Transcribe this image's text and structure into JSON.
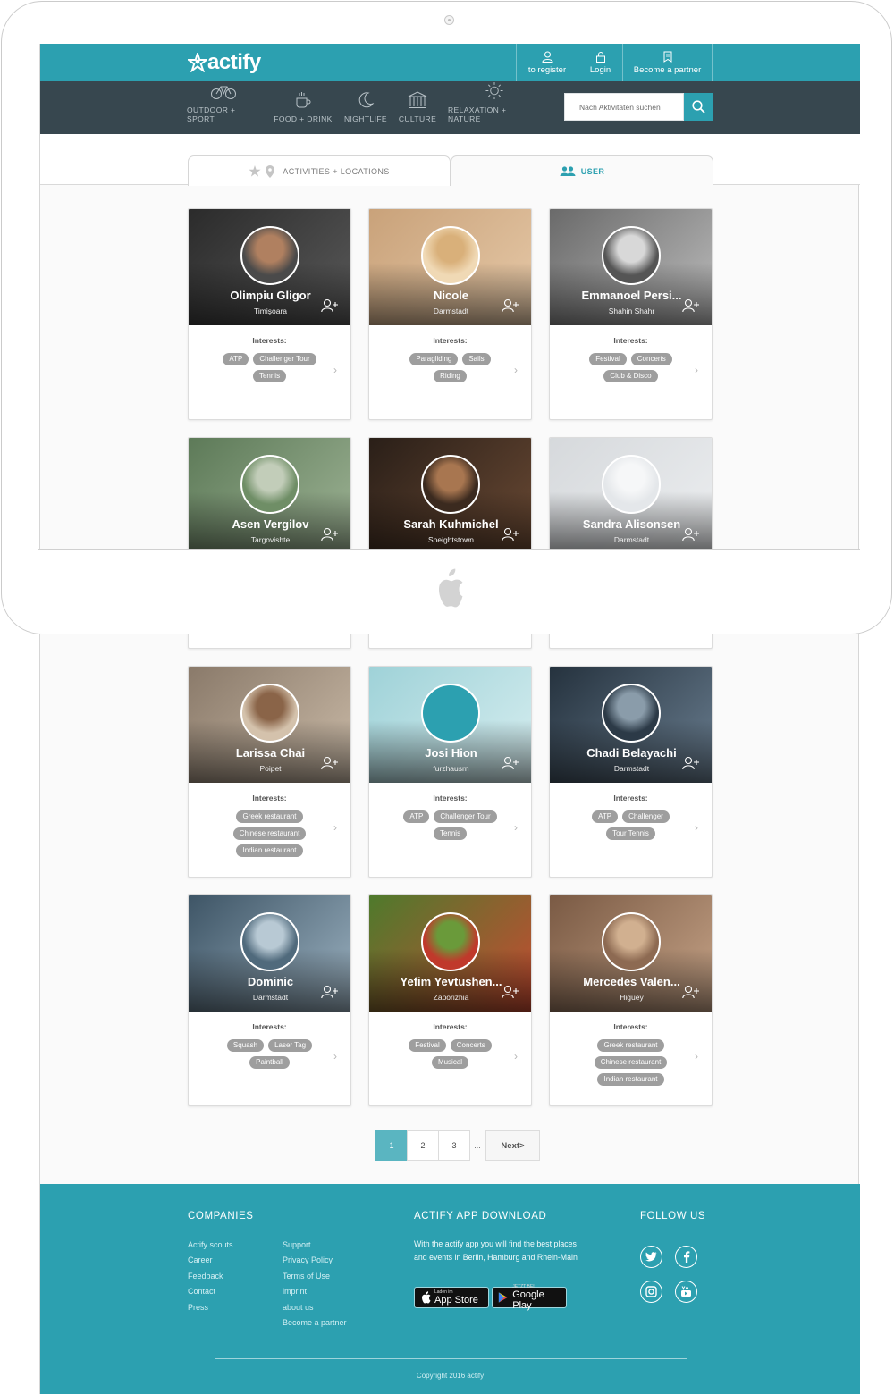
{
  "header": {
    "logo": "actify",
    "top_links": [
      {
        "label": "to register",
        "icon": "user-icon"
      },
      {
        "label": "Login",
        "icon": "lock-icon"
      },
      {
        "label": "Become a partner",
        "icon": "document-icon"
      }
    ]
  },
  "nav": {
    "items": [
      {
        "label": "OUTDOOR + SPORT",
        "icon": "bicycle-icon"
      },
      {
        "label": "FOOD + DRINK",
        "icon": "coffee-icon"
      },
      {
        "label": "NIGHTLIFE",
        "icon": "moon-icon"
      },
      {
        "label": "CULTURE",
        "icon": "museum-icon"
      },
      {
        "label": "RELAXATION + NATURE",
        "icon": "sun-icon"
      }
    ],
    "search_placeholder": "Nach Aktivitäten suchen"
  },
  "tabs": [
    {
      "label": "ACTIVITIES + LOCATIONS",
      "active": false
    },
    {
      "label": "USER",
      "active": true
    }
  ],
  "interests_label": "Interests:",
  "users": [
    {
      "name": "Olimpiu Gligor",
      "city": "Timișoara",
      "interests": [
        "ATP",
        "Challenger Tour",
        "Tennis"
      ],
      "colors": [
        "#2b2b2b",
        "#5a5a5a"
      ],
      "avatar": [
        "#4a4a4a",
        "#b08060"
      ]
    },
    {
      "name": "Nicole",
      "city": "Darmstadt",
      "interests": [
        "Paragliding",
        "Sails",
        "Riding"
      ],
      "colors": [
        "#c9a27a",
        "#e6c9a8"
      ],
      "avatar": [
        "#f0d9b5",
        "#d9b07a"
      ]
    },
    {
      "name": "Emmanoel Persi...",
      "city": "Shahin Shahr",
      "interests": [
        "Festival",
        "Concerts",
        "Club & Disco"
      ],
      "colors": [
        "#6a6a6a",
        "#bdbdbd"
      ],
      "avatar": [
        "#555555",
        "#d8d8d8"
      ]
    },
    {
      "name": "Asen Vergilov",
      "city": "Targovishte",
      "interests": [],
      "colors": [
        "#5d7a58",
        "#9fb496"
      ],
      "avatar": [
        "#6f8e66",
        "#c2cdb9"
      ]
    },
    {
      "name": "Sarah Kuhmichel",
      "city": "Speightstown",
      "interests": [],
      "colors": [
        "#2a1f18",
        "#6b4a34"
      ],
      "avatar": [
        "#3b2a1f",
        "#a87650"
      ]
    },
    {
      "name": "Sandra Alisonsen",
      "city": "Darmstadt",
      "interests": [],
      "colors": [
        "#d6d9dc",
        "#eceef0"
      ],
      "avatar": [
        "#e4e7ea",
        "#f6f7f8"
      ]
    },
    {
      "name": "Larissa Chai",
      "city": "Poipet",
      "interests": [
        "Greek restaurant",
        "Chinese restaurant",
        "Indian restaurant"
      ],
      "colors": [
        "#8a7a6a",
        "#cbbba8"
      ],
      "avatar": [
        "#d4c2ac",
        "#8a6448"
      ]
    },
    {
      "name": "Josi Hion",
      "city": "furzhausrn",
      "interests": [
        "ATP",
        "Challenger Tour",
        "Tennis"
      ],
      "colors": [
        "#9fd2d8",
        "#d7eef0"
      ],
      "avatar": [
        "#2ca0b0",
        "#2ca0b0"
      ]
    },
    {
      "name": "Chadi Belayachi",
      "city": "Darmstadt",
      "interests": [
        "ATP",
        "Challenger",
        "Tour Tennis"
      ],
      "colors": [
        "#25323e",
        "#6a7e90"
      ],
      "avatar": [
        "#2c3a47",
        "#8a9caa"
      ]
    },
    {
      "name": "Dominic",
      "city": "Darmstadt",
      "interests": [
        "Squash",
        "Laser Tag",
        "Paintball"
      ],
      "colors": [
        "#3e5566",
        "#9db3c2"
      ],
      "avatar": [
        "#506a7c",
        "#b8c9d4"
      ]
    },
    {
      "name": "Yefim Yevtushen...",
      "city": "Zaporizhia",
      "interests": [
        "Festival",
        "Concerts",
        "Musical"
      ],
      "colors": [
        "#4e7a2c",
        "#c94a32"
      ],
      "avatar": [
        "#c0392b",
        "#6a9a3a"
      ]
    },
    {
      "name": "Mercedes Valen...",
      "city": "Higüey",
      "interests": [
        "Greek restaurant",
        "Chinese restaurant",
        "Indian restaurant"
      ],
      "colors": [
        "#7a5a44",
        "#c7a488"
      ],
      "avatar": [
        "#8d6a52",
        "#d1b090"
      ]
    }
  ],
  "pagination": {
    "pages": [
      "1",
      "2",
      "3"
    ],
    "active": "1",
    "ellipsis": "...",
    "next": "Next>"
  },
  "footer": {
    "companies_title": "COMPANIES",
    "companies_col1": [
      "Actify scouts",
      "Career",
      "Feedback",
      "Contact",
      "Press"
    ],
    "companies_col2": [
      "Support",
      "Privacy Policy",
      "Terms of Use",
      "imprint",
      "about us",
      "Become a partner"
    ],
    "app_title": "ACTIFY APP DOWNLOAD",
    "app_text": "With the actify app you will find the best places and events in Berlin, Hamburg and Rhein-Main",
    "appstore_small": "Laden im",
    "appstore_big": "App Store",
    "googleplay_small": "JETZT BEI",
    "googleplay_big": "Google Play",
    "follow_title": "FOLLOW US",
    "social": [
      "twitter-icon",
      "facebook-icon",
      "instagram-icon",
      "youtube-icon"
    ],
    "copyright": "Copyright 2016 actify"
  },
  "colors": {
    "brand": "#2ca0b0",
    "nav": "#37474f",
    "tag": "#9e9e9e"
  }
}
